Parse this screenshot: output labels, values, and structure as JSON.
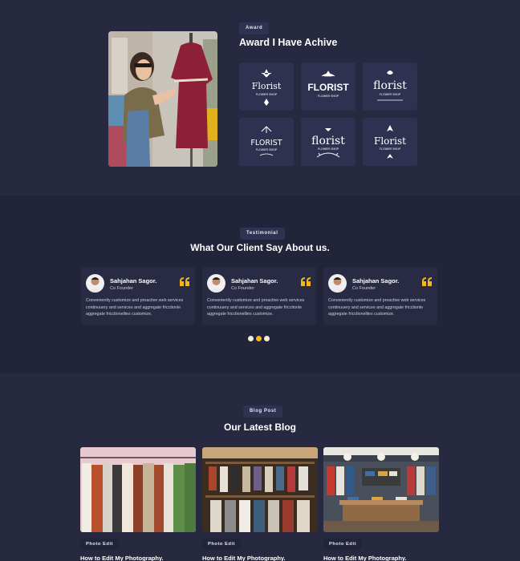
{
  "award": {
    "tag": "Award",
    "title": "Award I Have Achive",
    "logos": [
      {
        "name": "Florist",
        "sub": "FLOWER SHOP"
      },
      {
        "name": "FLORIST",
        "sub": "FLOWER SHOP"
      },
      {
        "name": "florist",
        "sub": "FLOWER SHOP"
      },
      {
        "name": "FLORIST",
        "sub": "FLOWER SHOP"
      },
      {
        "name": "florist",
        "sub": "FLOWER SHOP"
      },
      {
        "name": "Florist",
        "sub": "FLOWER SHOP"
      }
    ]
  },
  "testimonial": {
    "tag": "Testimonial",
    "title": "What Our Client Say About us.",
    "cards": [
      {
        "name": "Sahjahan Sagor.",
        "role": "Co Founder",
        "text": "Conveniently customize and proactive web services continuuery and services and aggregate fricctionle aggregate fricctionellies customize."
      },
      {
        "name": "Sahjahan Sagor.",
        "role": "Co Founder",
        "text": "Conveniently customize and proactive web services continuuery and services and aggregate fricctionle aggregate fricctionellies customize."
      },
      {
        "name": "Sahjahan Sagor.",
        "role": "Co Founder",
        "text": "Conveniently customize and proactive web services continuuery and services and aggregate fricctionle aggregate fricctionellies customize."
      }
    ],
    "active_dot": 2,
    "colors": {
      "dot_active": "#f5b619",
      "dot_inactive": "#f3ecd6",
      "quote": "#f5b619"
    }
  },
  "blog": {
    "tag": "Blog Post",
    "title": "Our Latest Blog",
    "posts": [
      {
        "tag": "Photo Edit",
        "title": "How to Edit My Photography."
      },
      {
        "tag": "Photo Edit",
        "title": "How to Edit My Photography."
      },
      {
        "tag": "Photo Edit",
        "title": "How to Edit My Photography."
      }
    ]
  }
}
